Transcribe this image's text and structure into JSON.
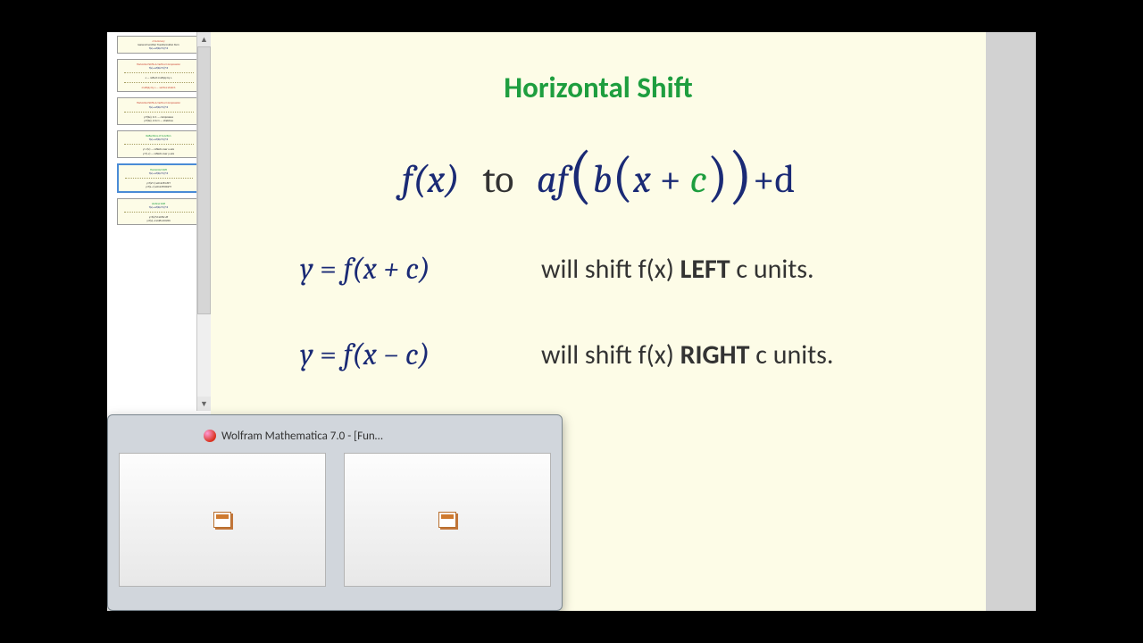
{
  "colors": {
    "bg": "#000000",
    "slide_bg": "#fdfce7",
    "accent_blue": "#1a2a75",
    "accent_green": "#1e9e3f",
    "text": "#333333"
  },
  "slide": {
    "title": "Horizontal Shift",
    "main_eq": {
      "lhs": "f(x)",
      "word_to": "to",
      "rhs_a": "af",
      "rhs_b": "b",
      "rhs_x": "x",
      "rhs_plus": "+",
      "rhs_c": "c",
      "rhs_tail": "+d"
    },
    "rows": [
      {
        "lhs_y": "y",
        "lhs_eq": " = ",
        "lhs_fn": "f(x + c)",
        "rhs_pre": "will shift f(x) ",
        "rhs_dir": "LEFT",
        "rhs_post": " c units."
      },
      {
        "lhs_y": "y",
        "lhs_eq": " = ",
        "lhs_fn": "f(x − c)",
        "rhs_pre": "will shift f(x) ",
        "rhs_dir": "RIGHT",
        "rhs_post": " c units."
      }
    ]
  },
  "taskbar": {
    "app_title": "Wolfram Mathematica 7.0 - [Fun…"
  },
  "thumbnails": [
    {
      "title": "A Summary",
      "line1": "General Function Transformation form",
      "eq": "f(x)→af(b(x+c))+d",
      "selected": false
    },
    {
      "title": "Horizontal Shifts & Vertical Compression",
      "eq": "f(x)→af(b(x+c))+d",
      "note1": "a — reflect",
      "note2": "multiply by a",
      "selected": false
    },
    {
      "title": "Horizontal Shifts & Vertical Compression",
      "eq": "f(x)→af(b(x+c))+d",
      "note1": "y=f(bx), b>1",
      "note2": "— compresses",
      "selected": false
    },
    {
      "title": "Reflections of Function",
      "eq": "f(x)→af(b(x+c))+d",
      "note1": "y=−f(x)",
      "note2": "reflects over x-axis",
      "selected": false
    },
    {
      "title": "Horizontal Shift",
      "eq": "f(x)→af(b(x+c))+d",
      "note1": "y=f(x+c) will shift LEFT",
      "note2": "y=f(x−c) will shift RIGHT",
      "selected": true
    },
    {
      "title": "Vertical Shift",
      "eq": "f(x)→af(b(x+c))+d",
      "note1": "y=f(x)+d shifts UP",
      "note2": "y=f(x)−d shifts DOWN",
      "selected": false
    }
  ]
}
